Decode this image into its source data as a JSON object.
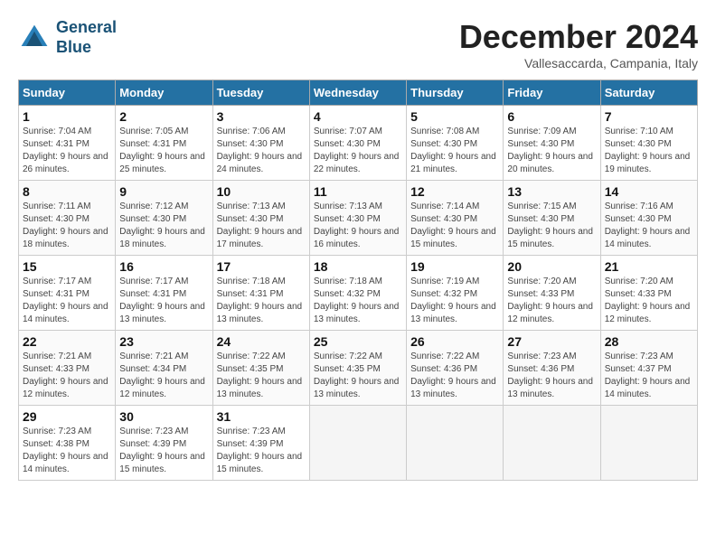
{
  "header": {
    "logo_line1": "General",
    "logo_line2": "Blue",
    "month": "December 2024",
    "location": "Vallesaccarda, Campania, Italy"
  },
  "weekdays": [
    "Sunday",
    "Monday",
    "Tuesday",
    "Wednesday",
    "Thursday",
    "Friday",
    "Saturday"
  ],
  "weeks": [
    [
      {
        "day": 1,
        "sunrise": "7:04 AM",
        "sunset": "4:31 PM",
        "daylight": "9 hours and 26 minutes."
      },
      {
        "day": 2,
        "sunrise": "7:05 AM",
        "sunset": "4:31 PM",
        "daylight": "9 hours and 25 minutes."
      },
      {
        "day": 3,
        "sunrise": "7:06 AM",
        "sunset": "4:30 PM",
        "daylight": "9 hours and 24 minutes."
      },
      {
        "day": 4,
        "sunrise": "7:07 AM",
        "sunset": "4:30 PM",
        "daylight": "9 hours and 22 minutes."
      },
      {
        "day": 5,
        "sunrise": "7:08 AM",
        "sunset": "4:30 PM",
        "daylight": "9 hours and 21 minutes."
      },
      {
        "day": 6,
        "sunrise": "7:09 AM",
        "sunset": "4:30 PM",
        "daylight": "9 hours and 20 minutes."
      },
      {
        "day": 7,
        "sunrise": "7:10 AM",
        "sunset": "4:30 PM",
        "daylight": "9 hours and 19 minutes."
      }
    ],
    [
      {
        "day": 8,
        "sunrise": "7:11 AM",
        "sunset": "4:30 PM",
        "daylight": "9 hours and 18 minutes."
      },
      {
        "day": 9,
        "sunrise": "7:12 AM",
        "sunset": "4:30 PM",
        "daylight": "9 hours and 18 minutes."
      },
      {
        "day": 10,
        "sunrise": "7:13 AM",
        "sunset": "4:30 PM",
        "daylight": "9 hours and 17 minutes."
      },
      {
        "day": 11,
        "sunrise": "7:13 AM",
        "sunset": "4:30 PM",
        "daylight": "9 hours and 16 minutes."
      },
      {
        "day": 12,
        "sunrise": "7:14 AM",
        "sunset": "4:30 PM",
        "daylight": "9 hours and 15 minutes."
      },
      {
        "day": 13,
        "sunrise": "7:15 AM",
        "sunset": "4:30 PM",
        "daylight": "9 hours and 15 minutes."
      },
      {
        "day": 14,
        "sunrise": "7:16 AM",
        "sunset": "4:30 PM",
        "daylight": "9 hours and 14 minutes."
      }
    ],
    [
      {
        "day": 15,
        "sunrise": "7:17 AM",
        "sunset": "4:31 PM",
        "daylight": "9 hours and 14 minutes."
      },
      {
        "day": 16,
        "sunrise": "7:17 AM",
        "sunset": "4:31 PM",
        "daylight": "9 hours and 13 minutes."
      },
      {
        "day": 17,
        "sunrise": "7:18 AM",
        "sunset": "4:31 PM",
        "daylight": "9 hours and 13 minutes."
      },
      {
        "day": 18,
        "sunrise": "7:18 AM",
        "sunset": "4:32 PM",
        "daylight": "9 hours and 13 minutes."
      },
      {
        "day": 19,
        "sunrise": "7:19 AM",
        "sunset": "4:32 PM",
        "daylight": "9 hours and 13 minutes."
      },
      {
        "day": 20,
        "sunrise": "7:20 AM",
        "sunset": "4:33 PM",
        "daylight": "9 hours and 12 minutes."
      },
      {
        "day": 21,
        "sunrise": "7:20 AM",
        "sunset": "4:33 PM",
        "daylight": "9 hours and 12 minutes."
      }
    ],
    [
      {
        "day": 22,
        "sunrise": "7:21 AM",
        "sunset": "4:33 PM",
        "daylight": "9 hours and 12 minutes."
      },
      {
        "day": 23,
        "sunrise": "7:21 AM",
        "sunset": "4:34 PM",
        "daylight": "9 hours and 12 minutes."
      },
      {
        "day": 24,
        "sunrise": "7:22 AM",
        "sunset": "4:35 PM",
        "daylight": "9 hours and 13 minutes."
      },
      {
        "day": 25,
        "sunrise": "7:22 AM",
        "sunset": "4:35 PM",
        "daylight": "9 hours and 13 minutes."
      },
      {
        "day": 26,
        "sunrise": "7:22 AM",
        "sunset": "4:36 PM",
        "daylight": "9 hours and 13 minutes."
      },
      {
        "day": 27,
        "sunrise": "7:23 AM",
        "sunset": "4:36 PM",
        "daylight": "9 hours and 13 minutes."
      },
      {
        "day": 28,
        "sunrise": "7:23 AM",
        "sunset": "4:37 PM",
        "daylight": "9 hours and 14 minutes."
      }
    ],
    [
      {
        "day": 29,
        "sunrise": "7:23 AM",
        "sunset": "4:38 PM",
        "daylight": "9 hours and 14 minutes."
      },
      {
        "day": 30,
        "sunrise": "7:23 AM",
        "sunset": "4:39 PM",
        "daylight": "9 hours and 15 minutes."
      },
      {
        "day": 31,
        "sunrise": "7:23 AM",
        "sunset": "4:39 PM",
        "daylight": "9 hours and 15 minutes."
      },
      null,
      null,
      null,
      null
    ]
  ]
}
